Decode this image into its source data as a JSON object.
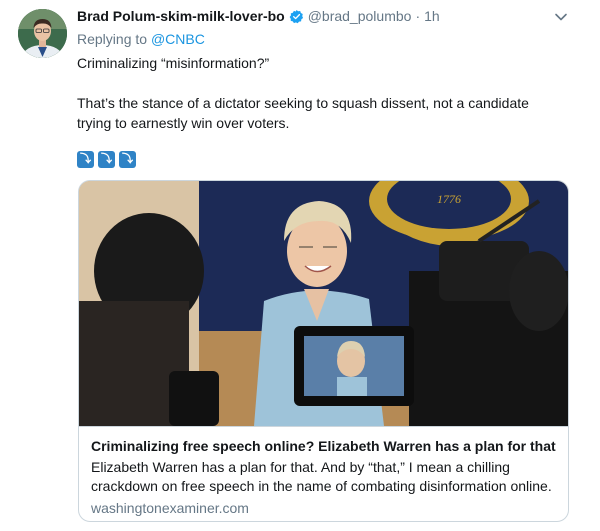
{
  "tweet": {
    "author": {
      "display_name": "Brad Polum-skim-milk-lover-bo",
      "handle": "@brad_polumbo",
      "verified": true,
      "avatar_icon": "avatar-photo"
    },
    "separator": "·",
    "time": "1h",
    "reply": {
      "prefix": "Replying to",
      "mention": "@CNBC"
    },
    "text_lines": [
      "Criminalizing “misinformation?”",
      "That’s the stance of a dictator seeking to squash dissent, not a candidate trying to earnestly win over voters."
    ],
    "emojis": [
      {
        "icon": "arrow-down-emoji",
        "glyph": "⤵"
      },
      {
        "icon": "arrow-down-emoji",
        "glyph": "⤵"
      },
      {
        "icon": "arrow-down-emoji",
        "glyph": "⤵"
      }
    ],
    "card": {
      "title": "Criminalizing free speech online? Elizabeth Warren has a plan for that",
      "description": "Elizabeth Warren has a plan for that. And by “that,” I mean a chilling crackdown on free speech in the name of combating disinformation online.",
      "domain": "washingtonexaminer.com",
      "seal_text": "1776"
    }
  },
  "colors": {
    "text": "#14171a",
    "secondary": "#657786",
    "link": "#1b95e0",
    "verified": "#1da1f2",
    "border": "#ccd6dd"
  }
}
